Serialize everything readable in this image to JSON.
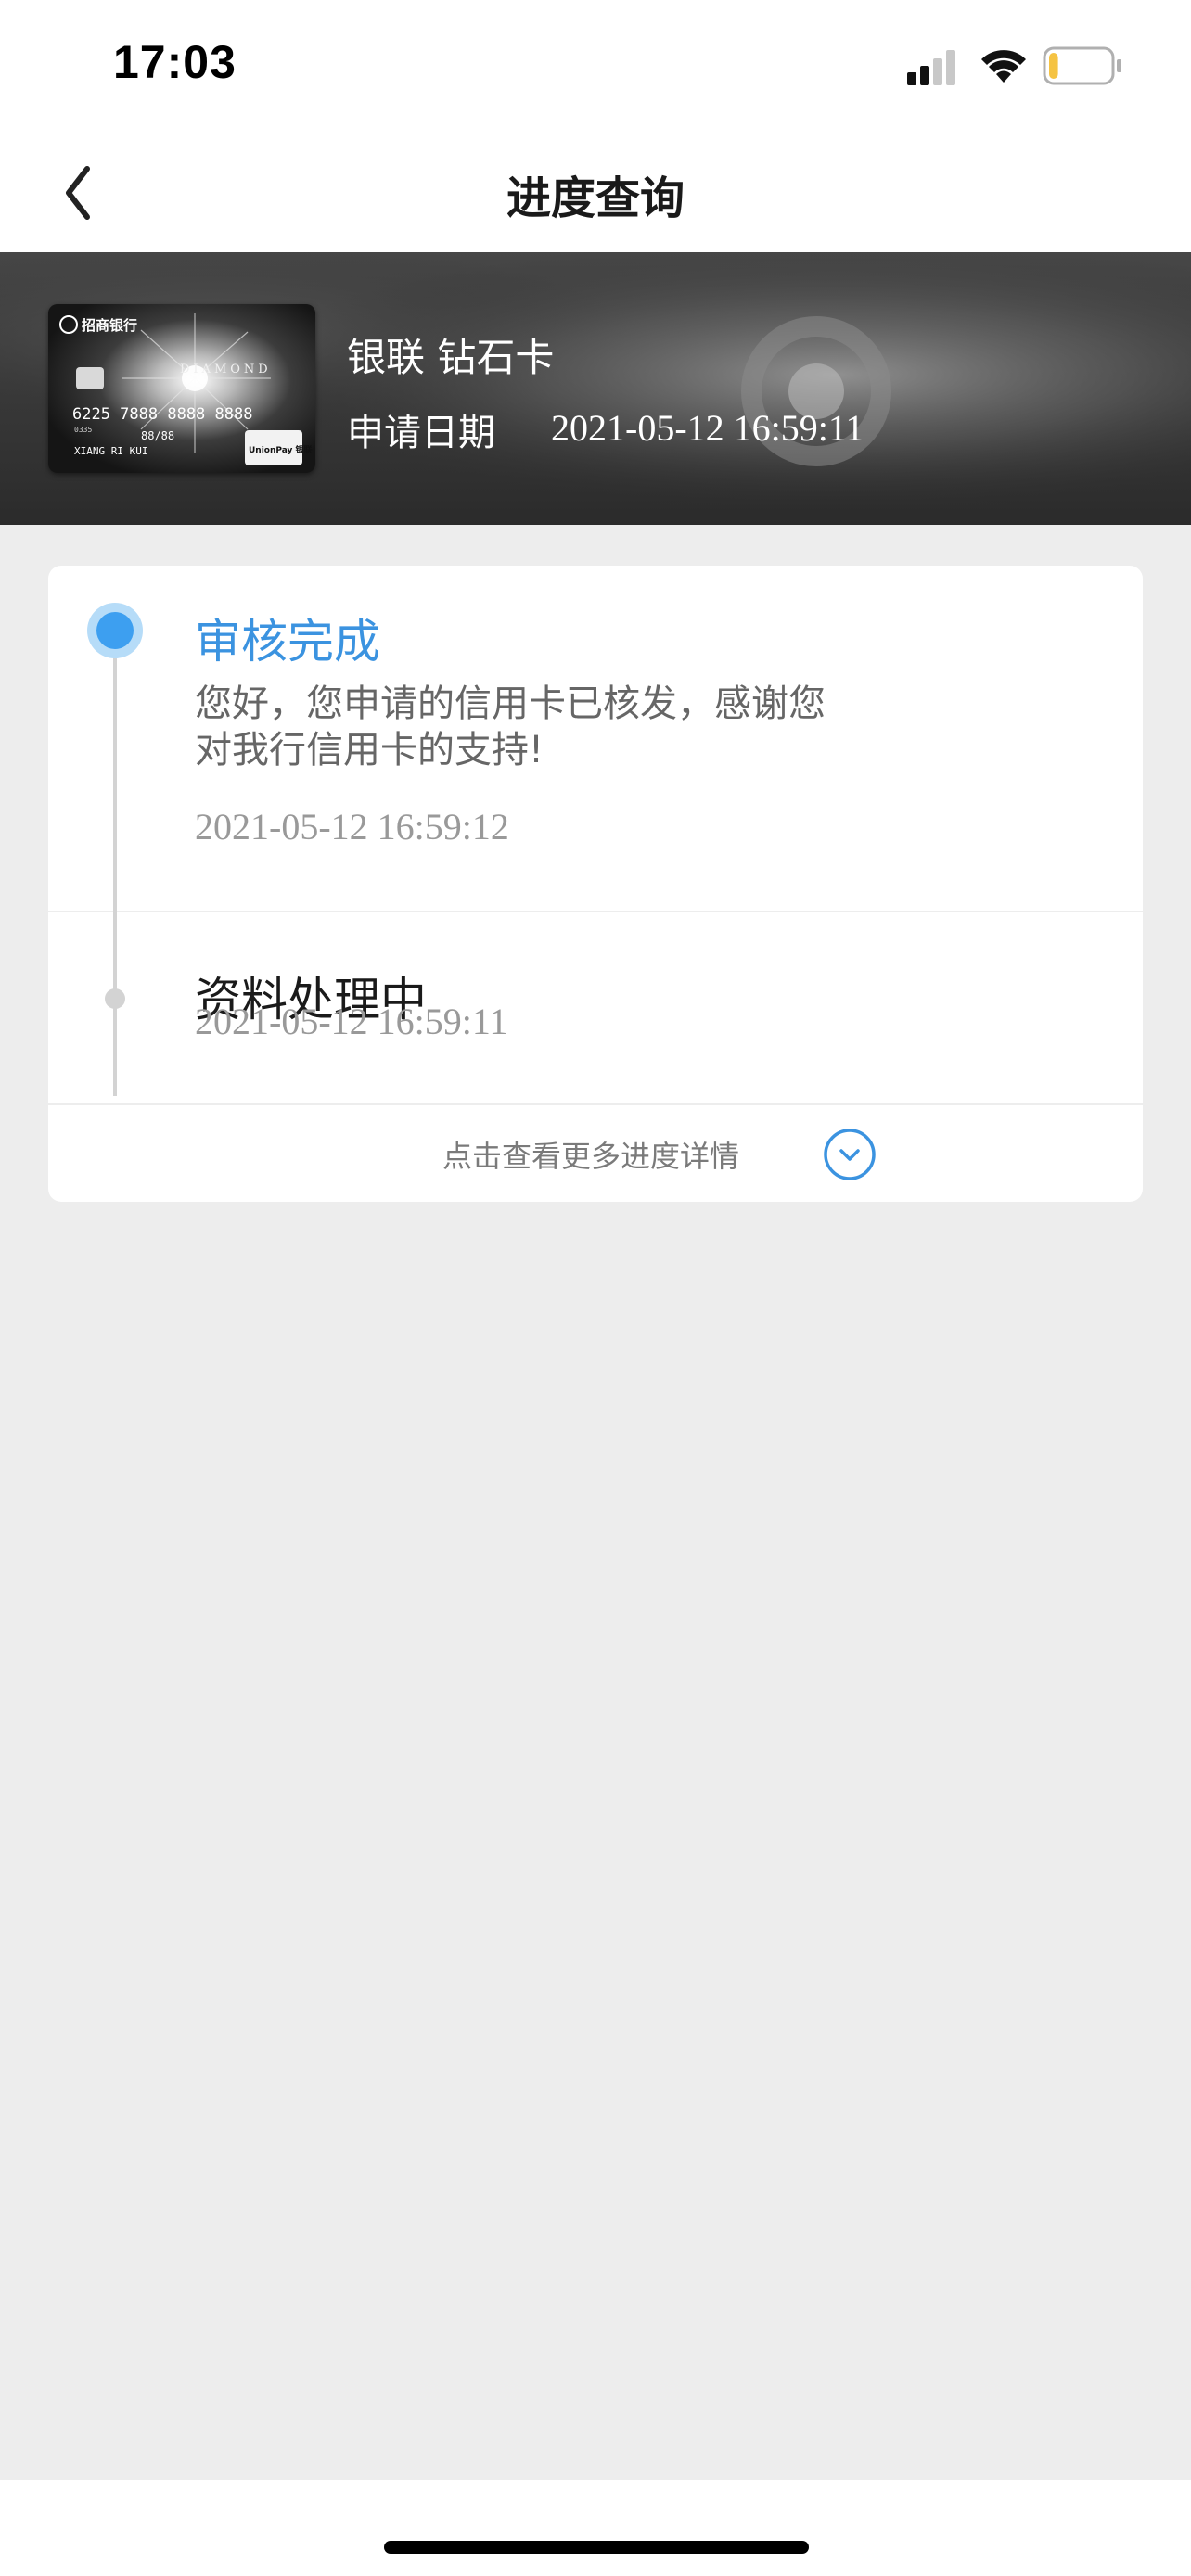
{
  "status_bar": {
    "time": "17:03",
    "signal_icon": "cellular-signal-icon",
    "wifi_icon": "wifi-icon",
    "battery_icon": "battery-low-icon",
    "battery_level": 0.15,
    "battery_color": "#f5c343"
  },
  "nav": {
    "title": "进度查询",
    "back_icon": "chevron-left-icon"
  },
  "card": {
    "name": "银联 钻石卡",
    "apply_label": "申请日期",
    "apply_date": "2021-05-12 16:59:11",
    "card_image": {
      "bank_name": "招商银行",
      "card_label": "DIAMOND",
      "card_number": "6225 7888 8888 8888",
      "card_small_code": "0335",
      "valid_thru": "88/88",
      "holder": "XIANG RI KUI",
      "network": "UnionPay 银联"
    }
  },
  "progress": {
    "accent_color": "#3b93e0",
    "steps": [
      {
        "title": "审核完成",
        "description_lines": [
          "您好，您申请的信用卡已核发，感谢您",
          "对我行信用卡的支持!"
        ],
        "time": "2021-05-12 16:59:12",
        "active": true
      },
      {
        "title": "资料处理中",
        "time": "2021-05-12 16:59:11",
        "active": false
      }
    ],
    "more_text": "点击查看更多进度详情",
    "more_icon": "chevron-down-circle-icon"
  }
}
